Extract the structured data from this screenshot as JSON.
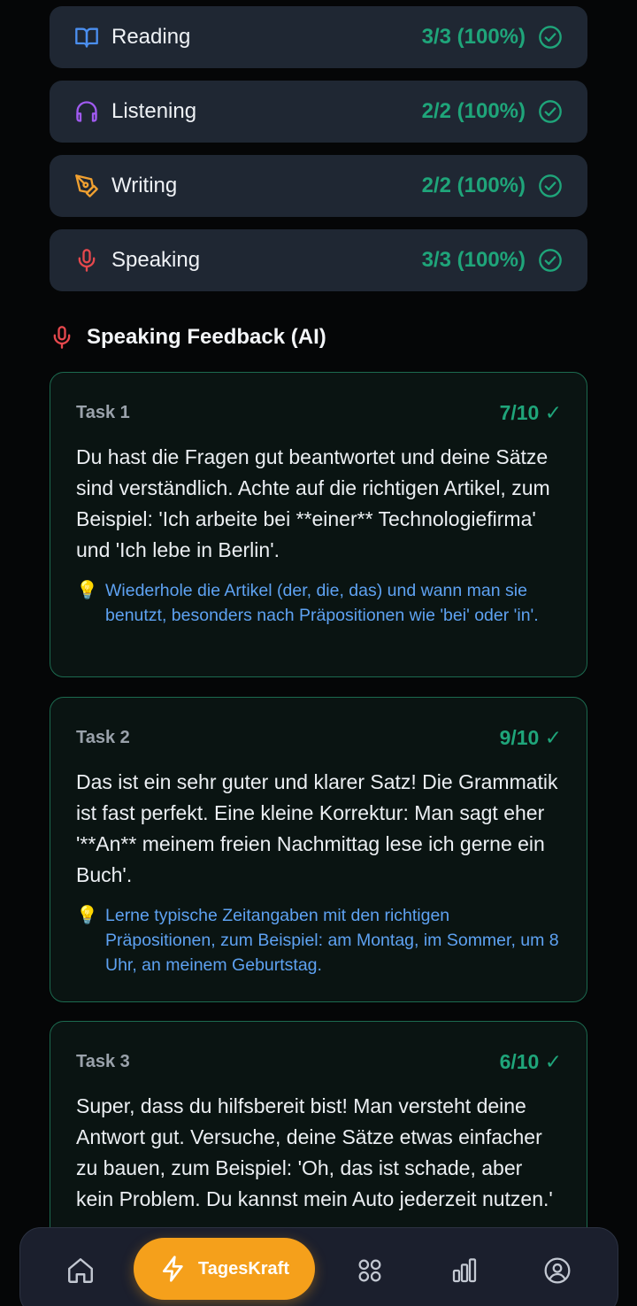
{
  "skills": [
    {
      "label": "Reading",
      "score": "3/3 (100%)",
      "icon": "book-icon",
      "color": "#4b8ff0"
    },
    {
      "label": "Listening",
      "score": "2/2 (100%)",
      "icon": "headphones-icon",
      "color": "#a05af0"
    },
    {
      "label": "Writing",
      "score": "2/2 (100%)",
      "icon": "pen-icon",
      "color": "#f0a030"
    },
    {
      "label": "Speaking",
      "score": "3/3 (100%)",
      "icon": "microphone-icon",
      "color": "#e5484d"
    }
  ],
  "feedback": {
    "title": "Speaking Feedback (AI)",
    "tasks": [
      {
        "label": "Task 1",
        "score": "7/10 ✓",
        "text": "Du hast die Fragen gut beantwortet und deine Sätze sind verständlich. Achte auf die richtigen Artikel, zum Beispiel: 'Ich arbeite bei **einer** Technologiefirma' und 'Ich lebe in Berlin'.",
        "tip": "Wiederhole die Artikel (der, die, das) und wann man sie benutzt, besonders nach Präpositionen wie 'bei' oder 'in'."
      },
      {
        "label": "Task 2",
        "score": "9/10 ✓",
        "text": "Das ist ein sehr guter und klarer Satz! Die Grammatik ist fast perfekt. Eine kleine Korrektur: Man sagt eher '**An** meinem freien Nachmittag lese ich gerne ein Buch'.",
        "tip": "Lerne typische Zeitangaben mit den richtigen Präpositionen, zum Beispiel: am Montag, im Sommer, um 8 Uhr, an meinem Geburtstag."
      },
      {
        "label": "Task 3",
        "score": "6/10 ✓",
        "text": "Super, dass du hilfsbereit bist! Man versteht deine Antwort gut. Versuche, deine Sätze etwas einfacher zu bauen, zum Beispiel: 'Oh, das ist schade, aber kein Problem. Du kannst mein Auto jederzeit nutzen.'",
        "tip": ""
      }
    ]
  },
  "nav": {
    "active_label": "TagesKraft",
    "items": [
      "home-icon",
      "lightning-icon",
      "grid-icon",
      "bar-chart-icon",
      "user-profile-icon"
    ]
  },
  "colors": {
    "accent": "#f5a01b",
    "success": "#1fa57a",
    "tip": "#5ea2f2"
  }
}
